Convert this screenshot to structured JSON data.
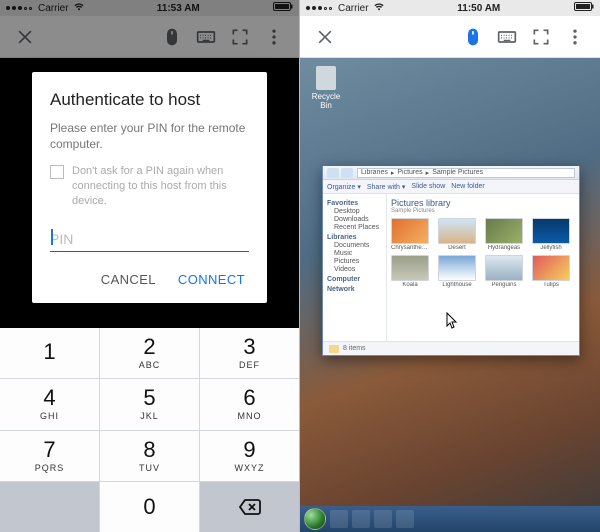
{
  "left": {
    "status": {
      "carrier": "Carrier",
      "time": "11:53 AM"
    },
    "toolbarIcons": [
      "close",
      "mouse",
      "keyboard",
      "fullscreen",
      "more"
    ],
    "modal": {
      "title": "Authenticate to host",
      "subtitle": "Please enter your PIN for the remote computer.",
      "checkboxLabel": "Don't ask for a PIN again when connecting to this host from this device.",
      "placeholder": "PIN",
      "cancel": "CANCEL",
      "connect": "CONNECT"
    },
    "keypad": [
      {
        "d": "1",
        "l": ""
      },
      {
        "d": "2",
        "l": "ABC"
      },
      {
        "d": "3",
        "l": "DEF"
      },
      {
        "d": "4",
        "l": "GHI"
      },
      {
        "d": "5",
        "l": "JKL"
      },
      {
        "d": "6",
        "l": "MNO"
      },
      {
        "d": "7",
        "l": "PQRS"
      },
      {
        "d": "8",
        "l": "TUV"
      },
      {
        "d": "9",
        "l": "WXYZ"
      }
    ],
    "keypadZero": "0"
  },
  "right": {
    "status": {
      "carrier": "Carrier",
      "time": "11:50 AM"
    },
    "toolbarIcons": [
      "close",
      "mouse",
      "keyboard",
      "fullscreen",
      "more"
    ],
    "desktop": {
      "recycleBin": "Recycle Bin"
    },
    "window": {
      "breadcrumb": [
        "Libraries",
        "Pictures",
        "Sample Pictures"
      ],
      "toolbar": [
        "Organize ▾",
        "Share with ▾",
        "Slide show",
        "New folder"
      ],
      "sidebar": {
        "favorites": {
          "label": "Favorites",
          "items": [
            "Desktop",
            "Downloads",
            "Recent Places"
          ]
        },
        "libraries": {
          "label": "Libraries",
          "items": [
            "Documents",
            "Music",
            "Pictures",
            "Videos"
          ]
        },
        "computer": {
          "label": "Computer"
        },
        "network": {
          "label": "Network"
        }
      },
      "mainTitle": "Pictures library",
      "mainSubtitle": "Sample Pictures",
      "thumbs": [
        {
          "name": "Chrysanthemum",
          "bg": "linear-gradient(135deg,#e07030,#f5b060)"
        },
        {
          "name": "Desert",
          "bg": "linear-gradient(#cde6f5,#d8b48a)"
        },
        {
          "name": "Hydrangeas",
          "bg": "linear-gradient(135deg,#6a7a4a,#9ab06a)"
        },
        {
          "name": "Jellyfish",
          "bg": "linear-gradient(#063a6a,#0a5aa8)"
        },
        {
          "name": "Koala",
          "bg": "linear-gradient(#9aa088,#c8c8b8)"
        },
        {
          "name": "Lighthouse",
          "bg": "linear-gradient(#7aa8d8,#ffffff)"
        },
        {
          "name": "Penguins",
          "bg": "linear-gradient(#dde8f2,#9ab0c0)"
        },
        {
          "name": "Tulips",
          "bg": "linear-gradient(135deg,#e05a5a,#f5d060)"
        }
      ],
      "status": "8 items"
    }
  }
}
